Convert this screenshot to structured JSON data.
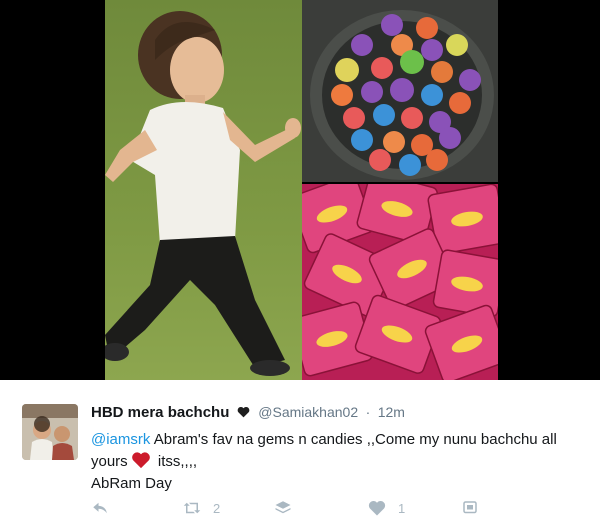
{
  "tweet": {
    "display_name": "HBD mera bachchu",
    "name_emoji": "black-heart-icon",
    "handle": "@Samiakhan02",
    "separator": "·",
    "timestamp": "12m",
    "mention": "@iamsrk",
    "text_part1": " Abram's fav na gems n candies ,,Come my nunu bachchu all yours",
    "emoji": "red-heart-icon",
    "text_part2": " itss,,,,",
    "text_line2": "AbRam Day"
  },
  "actions": {
    "reply_icon": "reply-icon",
    "retweet_icon": "retweet-icon",
    "retweet_count": "2",
    "stack_icon": "layers-icon",
    "like_icon": "heart-icon",
    "like_count": "1",
    "more_icon": "more-icon"
  },
  "colors": {
    "mention": "#1b95e0",
    "meta_gray": "#657786",
    "action_gray": "#aab8c2",
    "heart_red": "#cc1b2b",
    "media_bg": "#000000"
  }
}
